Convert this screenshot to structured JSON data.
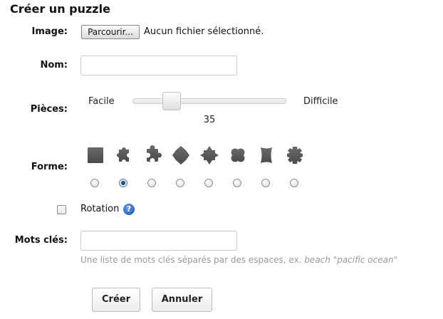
{
  "form": {
    "title": "Créer un puzzle",
    "image": {
      "label": "Image:",
      "browse_button": "Parcourir...",
      "file_status": "Aucun fichier sélectionné."
    },
    "name": {
      "label": "Nom:",
      "value": ""
    },
    "pieces": {
      "label": "Pièces:",
      "min_label": "Facile",
      "max_label": "Difficile",
      "value": "35",
      "position_fraction": 0.22
    },
    "shape": {
      "label": "Forme:",
      "options": [
        {
          "icon": "square-piece-icon",
          "selected": false
        },
        {
          "icon": "classic-jigsaw-piece-icon",
          "selected": true
        },
        {
          "icon": "rounded-jigsaw-piece-icon",
          "selected": false
        },
        {
          "icon": "pointed-piece-icon",
          "selected": false
        },
        {
          "icon": "star-piece-icon",
          "selected": false
        },
        {
          "icon": "wavy-piece-icon",
          "selected": false
        },
        {
          "icon": "concave-piece-icon",
          "selected": false
        },
        {
          "icon": "gear-piece-icon",
          "selected": false
        }
      ],
      "piece_color": "#4a4a4a"
    },
    "rotation": {
      "label": "Rotation",
      "checked": false,
      "help_icon": "question-help-icon",
      "help_glyph": "?"
    },
    "keywords": {
      "label": "Mots clés:",
      "value": "",
      "hint_prefix": "Une liste de mots clés séparés par des espaces, ex.",
      "hint_example": "beach \"pacific ocean\""
    },
    "buttons": {
      "create": "Créer",
      "cancel": "Annuler"
    }
  }
}
